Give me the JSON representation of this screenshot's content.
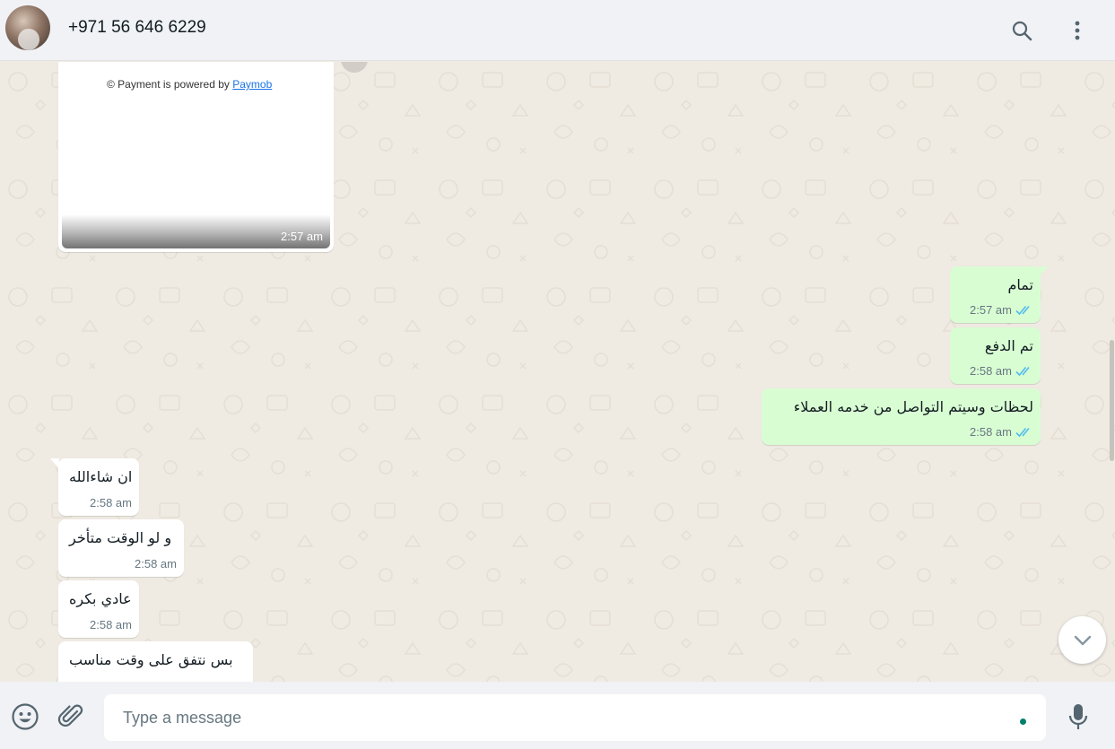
{
  "header": {
    "contact_name": "+971 56 646 6229",
    "icons": [
      "avatar",
      "search-icon",
      "menu-icon"
    ]
  },
  "image_message": {
    "caption_prefix": "© Payment is powered by ",
    "caption_link": "Paymob",
    "time": "2:57 am"
  },
  "messages": [
    {
      "direction": "out",
      "text": "تمام",
      "time": "2:57 am",
      "status": "read"
    },
    {
      "direction": "out",
      "text": "تم الدفع",
      "time": "2:58 am",
      "status": "read"
    },
    {
      "direction": "out",
      "text": "لحظات وسيتم التواصل من خدمه العملاء",
      "time": "2:58 am",
      "status": "read"
    },
    {
      "direction": "in",
      "text": "ان شاءالله",
      "time": "2:58 am"
    },
    {
      "direction": "in",
      "text": "و لو الوقت متأخر",
      "time": "2:58 am"
    },
    {
      "direction": "in",
      "text": "عادي بكره",
      "time": "2:58 am"
    },
    {
      "direction": "in",
      "text": "بس نتفق على وقت مناسب",
      "time": ""
    }
  ],
  "composer": {
    "placeholder": "Type a message",
    "icons": [
      "emoji-icon",
      "attach-icon",
      "microphone-icon"
    ]
  },
  "colors": {
    "incoming": "#ffffff",
    "outgoing": "#d9fdd3",
    "chat_bg": "#efeae2",
    "panel_bg": "#f0f2f5",
    "read_ticks": "#53bdeb"
  }
}
